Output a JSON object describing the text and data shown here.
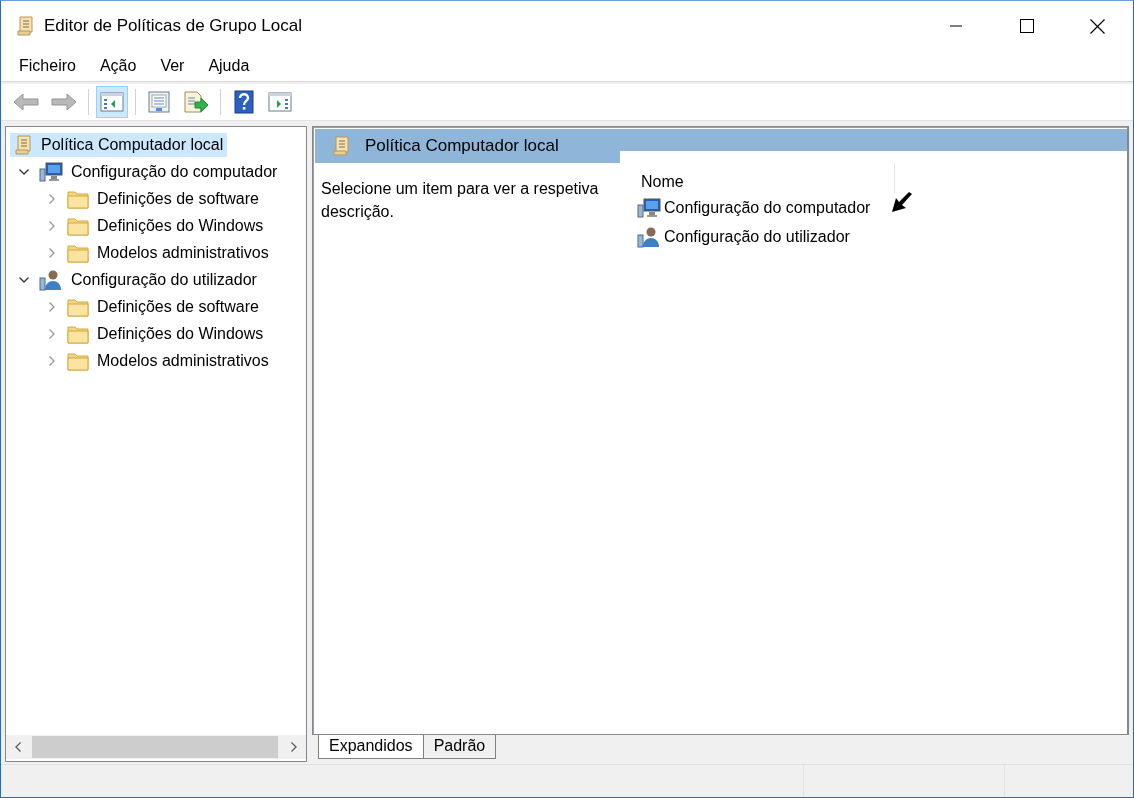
{
  "window": {
    "title": "Editor de Políticas de Grupo Local"
  },
  "menu": [
    "Ficheiro",
    "Ação",
    "Ver",
    "Ajuda"
  ],
  "toolbar": [
    {
      "kind": "back",
      "disabled": true,
      "pressed": false
    },
    {
      "kind": "forward",
      "disabled": true,
      "pressed": false
    },
    {
      "kind": "separator"
    },
    {
      "kind": "tree",
      "disabled": false,
      "pressed": true
    },
    {
      "kind": "separator"
    },
    {
      "kind": "properties",
      "disabled": false,
      "pressed": false
    },
    {
      "kind": "export",
      "disabled": false,
      "pressed": false
    },
    {
      "kind": "separator"
    },
    {
      "kind": "help",
      "disabled": false,
      "pressed": false
    },
    {
      "kind": "actions",
      "disabled": false,
      "pressed": false
    }
  ],
  "tree": [
    {
      "label": "Política Computador local",
      "kind": "policy",
      "selected": true,
      "children": [
        {
          "label": "Configuração do computador",
          "kind": "computer",
          "selected": false,
          "expanded": true,
          "children": [
            {
              "label": "Definições de software",
              "kind": "folder",
              "selected": false,
              "expanded": false
            },
            {
              "label": "Definições do Windows",
              "kind": "folder",
              "selected": false,
              "expanded": false
            },
            {
              "label": "Modelos administrativos",
              "kind": "folder",
              "selected": false,
              "expanded": false
            }
          ]
        },
        {
          "label": "Configuração do utilizador",
          "kind": "user",
          "selected": false,
          "expanded": true,
          "children": [
            {
              "label": "Definições de software",
              "kind": "folder",
              "selected": false,
              "expanded": false
            },
            {
              "label": "Definições do Windows",
              "kind": "folder",
              "selected": false,
              "expanded": false
            },
            {
              "label": "Modelos administrativos",
              "kind": "folder",
              "selected": false,
              "expanded": false
            }
          ]
        }
      ]
    }
  ],
  "details": {
    "header": "Política Computador local",
    "description": "Selecione um item para ver a respetiva descrição.",
    "column": "Nome",
    "items": [
      {
        "label": "Configuração do computador",
        "kind": "computer"
      },
      {
        "label": "Configuração do utilizador",
        "kind": "user"
      }
    ],
    "tabs": [
      {
        "label": "Expandidos",
        "selected": true
      },
      {
        "label": "Padrão",
        "selected": false
      }
    ]
  }
}
